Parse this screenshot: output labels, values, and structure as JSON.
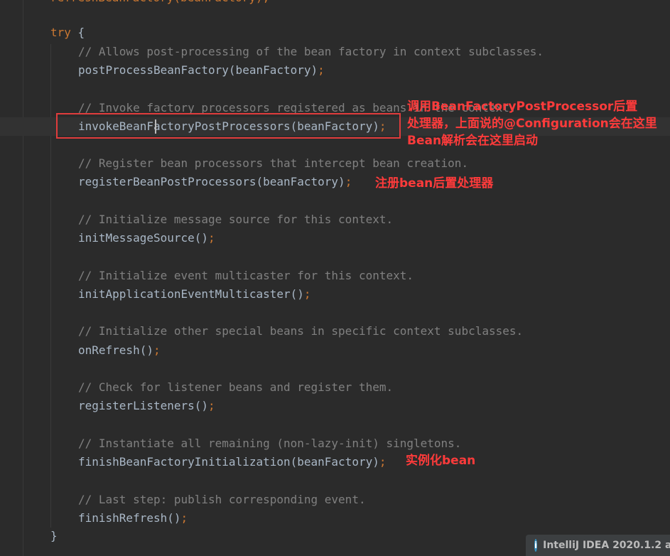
{
  "editor": {
    "top_partial": "refreshBeanFactory(beanFactory);",
    "try_keyword": "try",
    "open_brace": " {",
    "lines": [
      {
        "text": "// Allows post-processing of the bean factory in context subclasses.",
        "kind": "comment"
      },
      {
        "text": "postProcessBeanFactory(beanFactory)",
        "kind": "code"
      },
      {
        "text": "// Invoke factory processors registered as beans in the context.",
        "kind": "comment"
      },
      {
        "text": "invokeBeanFactoryPostProcessors(beanFactory)",
        "kind": "code"
      },
      {
        "text": "// Register bean processors that intercept bean creation.",
        "kind": "comment"
      },
      {
        "text": "registerBeanPostProcessors(beanFactory)",
        "kind": "code"
      },
      {
        "text": "// Initialize message source for this context.",
        "kind": "comment"
      },
      {
        "text": "initMessageSource()",
        "kind": "code"
      },
      {
        "text": "// Initialize event multicaster for this context.",
        "kind": "comment"
      },
      {
        "text": "initApplicationEventMulticaster()",
        "kind": "code"
      },
      {
        "text": "// Initialize other special beans in specific context subclasses.",
        "kind": "comment"
      },
      {
        "text": "onRefresh()",
        "kind": "code"
      },
      {
        "text": "// Check for listener beans and register them.",
        "kind": "comment"
      },
      {
        "text": "registerListeners()",
        "kind": "code"
      },
      {
        "text": "// Instantiate all remaining (non-lazy-init) singletons.",
        "kind": "comment"
      },
      {
        "text": "finishBeanFactoryInitialization(beanFactory)",
        "kind": "code"
      },
      {
        "text": "// Last step: publish corresponding event.",
        "kind": "comment"
      },
      {
        "text": "finishRefresh()",
        "kind": "code"
      }
    ],
    "semicolon": ";",
    "close_brace": "}"
  },
  "annotations": {
    "invoke_note_line1": "调用BeanFactoryPostProcessor后置",
    "invoke_note_line2": "处理器，上面说的@Configuration会在这里",
    "invoke_note_line3": "Bean解析会在这里启动",
    "register_note": "注册bean后置处理器",
    "finish_note": "实例化bean"
  },
  "status_bar": {
    "info_icon": "i",
    "text": "IntelliJ IDEA 2020.1.2 a"
  },
  "colors": {
    "background": "#2b2b2b",
    "keyword": "#cc7832",
    "comment": "#808080",
    "code": "#a9b7c6",
    "annotation_red": "#ff3b3b",
    "highlight_box": "#e03c3c"
  }
}
